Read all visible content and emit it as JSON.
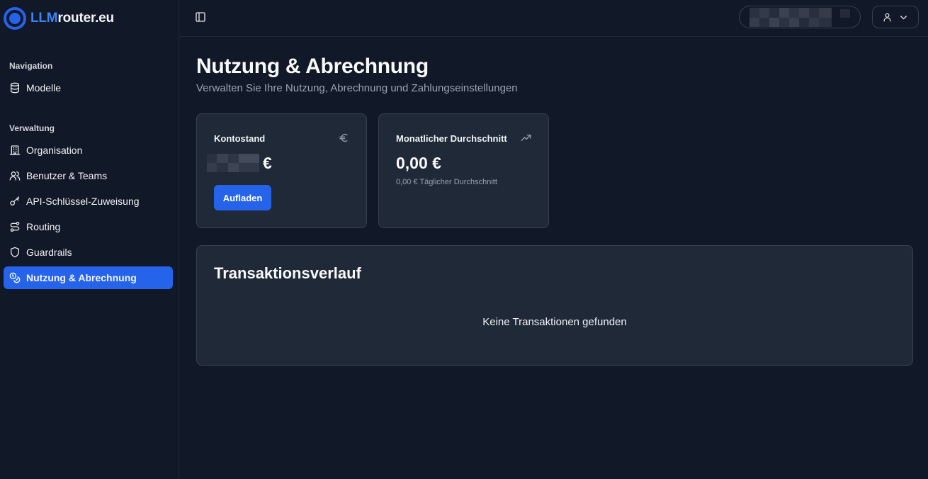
{
  "brand": {
    "part1": "LLM",
    "part2": "router.eu"
  },
  "sidebar": {
    "sections": [
      {
        "label": "Navigation"
      },
      {
        "label": "Verwaltung"
      }
    ],
    "items": [
      {
        "label": "Modelle",
        "icon": "database-icon"
      },
      {
        "label": "Organisation",
        "icon": "building-icon"
      },
      {
        "label": "Benutzer & Teams",
        "icon": "users-icon"
      },
      {
        "label": "API-Schlüssel-Zuweisung",
        "icon": "key-icon"
      },
      {
        "label": "Routing",
        "icon": "route-icon"
      },
      {
        "label": "Guardrails",
        "icon": "shield-icon"
      },
      {
        "label": "Nutzung & Abrechnung",
        "icon": "coins-icon",
        "active": true
      }
    ]
  },
  "header": {
    "sidebar_toggle_icon": "panel-left-icon",
    "user_icon": "user-icon",
    "chevron_icon": "chevron-down-icon"
  },
  "page": {
    "title": "Nutzung & Abrechnung",
    "subtitle": "Verwalten Sie Ihre Nutzung, Abrechnung und Zahlungseinstellungen"
  },
  "cards": {
    "balance": {
      "title": "Kontostand",
      "icon": "euro-icon",
      "currency": "€",
      "button": "Aufladen"
    },
    "average": {
      "title": "Monatlicher Durchschnitt",
      "icon": "trending-up-icon",
      "value": "0,00 €",
      "note": "0,00 € Täglicher Durchschnitt"
    }
  },
  "transactions": {
    "title": "Transaktionsverlauf",
    "empty": "Keine Transaktionen gefunden"
  },
  "colors": {
    "background": "#111827",
    "card": "#1f2937",
    "border": "#374151",
    "accent": "#2563eb",
    "muted_text": "#9ca3af"
  }
}
